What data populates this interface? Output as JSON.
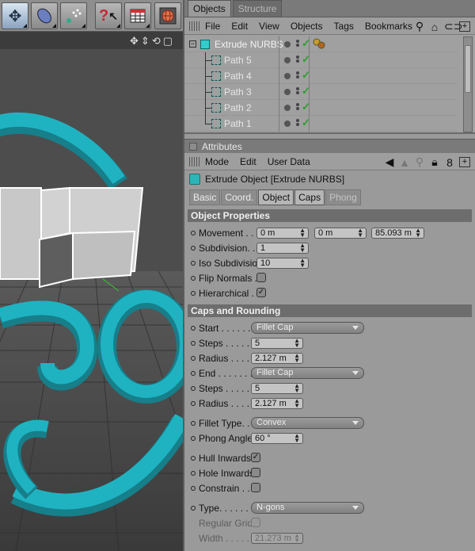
{
  "toolbar": {
    "icons": [
      "scale-arrows-icon",
      "capsule-icon",
      "particle-icon",
      "help-cursor-icon",
      "timeline-icon",
      "render-globe-icon"
    ]
  },
  "viewport": {
    "nav_icons": "✥⇕⟲▢"
  },
  "object_manager": {
    "tabs": [
      "Objects",
      "Structure"
    ],
    "menu": [
      "File",
      "Edit",
      "View",
      "Objects",
      "Tags",
      "Bookmarks"
    ],
    "objects": [
      {
        "name": "Extrude NURBS",
        "level": 0
      },
      {
        "name": "Path 5",
        "level": 1
      },
      {
        "name": "Path 4",
        "level": 1
      },
      {
        "name": "Path 3",
        "level": 1
      },
      {
        "name": "Path 2",
        "level": 1
      },
      {
        "name": "Path 1",
        "level": 1
      }
    ]
  },
  "attributes": {
    "header": "Attributes",
    "menu": [
      "Mode",
      "Edit",
      "User Data"
    ],
    "object_title": "Extrude Object [Extrude NURBS]",
    "tabs": [
      "Basic",
      "Coord.",
      "Object",
      "Caps",
      "Phong"
    ],
    "object_properties": {
      "title": "Object Properties",
      "movement_label": "Movement . . .",
      "movement": [
        "0 m",
        "0 m",
        "85.093 m"
      ],
      "subdivision_label": "Subdivision. . .",
      "subdivision": "1",
      "iso_label": "Iso Subdivision",
      "iso": "10",
      "flip_label": "Flip Normals . .",
      "flip_checked": false,
      "hier_label": "Hierarchical . .",
      "hier_checked": true
    },
    "caps": {
      "title": "Caps and Rounding",
      "start_label": "Start . . . . . . .",
      "start": "Fillet Cap",
      "steps1_label": "Steps . . . . . .",
      "steps1": "5",
      "radius1_label": "Radius . . . . .",
      "radius1": "2.127 m",
      "end_label": "End . . . . . . .",
      "end": "Fillet Cap",
      "steps2_label": "Steps . . . . . .",
      "steps2": "5",
      "radius2_label": "Radius . . . . .",
      "radius2": "2.127 m",
      "fillet_type_label": "Fillet Type. . .",
      "fillet_type": "Convex",
      "phong_label": "Phong Angle",
      "phong": "60 °",
      "hull_label": "Hull Inwards",
      "hull_checked": true,
      "hole_label": "Hole Inwards",
      "hole_checked": false,
      "constrain_label": "Constrain . . .",
      "constrain_checked": false,
      "type_label": "Type. . . . . . . .",
      "type": "N-gons",
      "regular_grid_label": "Regular Grid",
      "width_label": "Width . . . . . .",
      "width": "21.273 m"
    }
  },
  "colors": {
    "accent_cyan": "#1fb3c2",
    "panel_bg": "#9a9a9a",
    "check_green": "#2d9e2d"
  }
}
